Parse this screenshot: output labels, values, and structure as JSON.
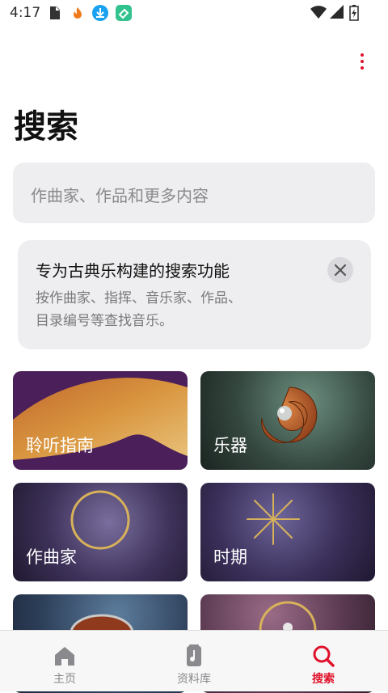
{
  "status_bar": {
    "time": "4:17"
  },
  "header": {
    "title": "搜索"
  },
  "search": {
    "placeholder": "作曲家、作品和更多内容"
  },
  "tip": {
    "title": "专为古典乐构建的搜索功能",
    "body": "按作曲家、指挥、音乐家、作品、目录编号等查找音乐。"
  },
  "categories": [
    {
      "label": "聆听指南"
    },
    {
      "label": "乐器"
    },
    {
      "label": "作曲家"
    },
    {
      "label": "时期"
    },
    {
      "label": ""
    },
    {
      "label": ""
    }
  ],
  "tabs": [
    {
      "label": "主页",
      "icon": "home-icon"
    },
    {
      "label": "资料库",
      "icon": "library-icon"
    },
    {
      "label": "搜索",
      "icon": "search-icon"
    }
  ],
  "colors": {
    "accent": "#e0112a",
    "field_bg": "#eeeef0"
  }
}
